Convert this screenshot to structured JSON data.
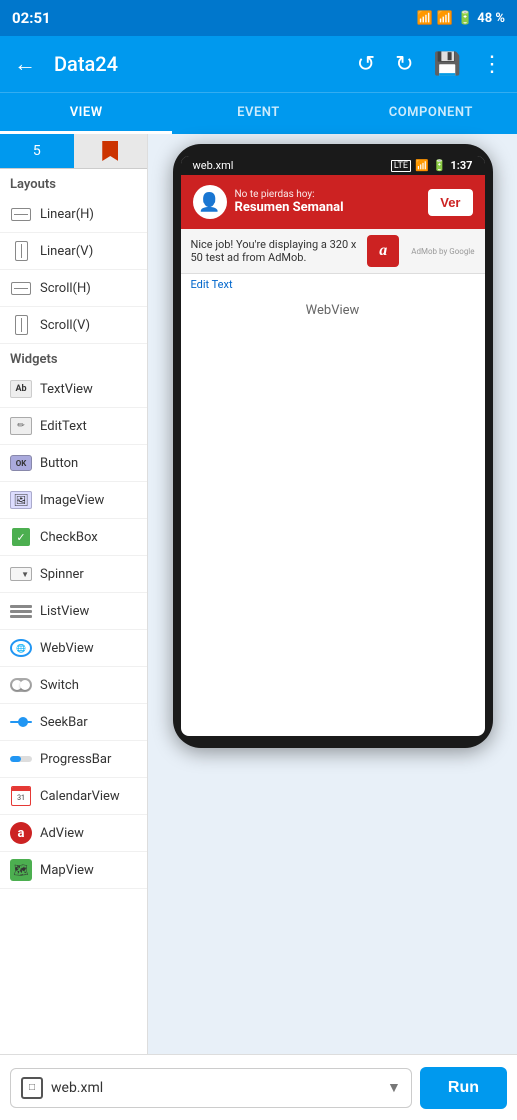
{
  "statusBar": {
    "time": "02:51",
    "battery": "48 %"
  },
  "appBar": {
    "title": "Data24",
    "backIcon": "←",
    "undoIcon": "↺",
    "redoIcon": "↻",
    "saveIcon": "💾",
    "moreIcon": "⋮"
  },
  "tabs": [
    {
      "id": "view",
      "label": "VIEW",
      "active": true
    },
    {
      "id": "event",
      "label": "EVENT",
      "active": false
    },
    {
      "id": "component",
      "label": "COMPONENT",
      "active": false
    }
  ],
  "sidebar": {
    "activeTab": 0,
    "sectionLayouts": "Layouts",
    "sectionWidgets": "Widgets",
    "layouts": [
      {
        "label": "Linear(H)",
        "icon": "▭"
      },
      {
        "label": "Linear(V)",
        "icon": "▯"
      },
      {
        "label": "Scroll(H)",
        "icon": "↔"
      },
      {
        "label": "Scroll(V)",
        "icon": "↕"
      }
    ],
    "widgets": [
      {
        "label": "TextView",
        "icon": "Ab"
      },
      {
        "label": "EditText",
        "icon": "✏"
      },
      {
        "label": "Button",
        "icon": "OK"
      },
      {
        "label": "ImageView",
        "icon": "🖼"
      },
      {
        "label": "CheckBox",
        "icon": "✅"
      },
      {
        "label": "Spinner",
        "icon": "↕"
      },
      {
        "label": "ListView",
        "icon": "≡"
      },
      {
        "label": "WebView",
        "icon": "🌐"
      },
      {
        "label": "Switch",
        "icon": "⬦"
      },
      {
        "label": "SeekBar",
        "icon": "—"
      },
      {
        "label": "ProgressBar",
        "icon": "▬"
      },
      {
        "label": "CalendarView",
        "icon": "📅"
      },
      {
        "label": "AdView",
        "icon": "📢"
      },
      {
        "label": "MapView",
        "icon": "🗺"
      }
    ]
  },
  "phone": {
    "filename": "web.xml",
    "time": "1:37",
    "notification": {
      "subtitle": "No te pierdas hoy:",
      "title": "Resumen Semanal",
      "buttonLabel": "Ver"
    },
    "adBanner": {
      "text": "Nice job! You're displaying a 320 x 50 test ad from AdMob.",
      "logoText": "a"
    },
    "editTextLink": "Edit Text",
    "webviewLabel": "WebView"
  },
  "bottomBar": {
    "fileName": "web.xml",
    "runLabel": "Run",
    "dropdownArrow": "▼"
  }
}
